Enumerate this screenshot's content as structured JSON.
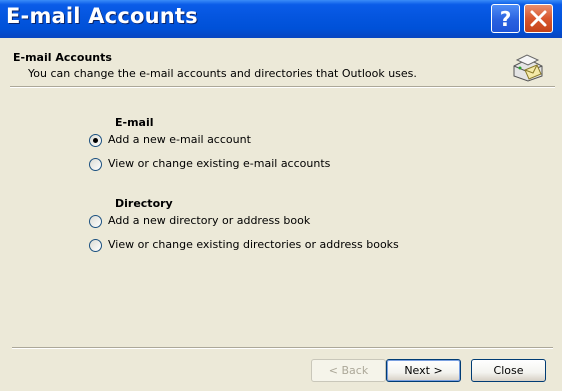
{
  "window": {
    "title": "E-mail Accounts",
    "colors": {
      "titlebar": "#0556e0",
      "face": "#ece9d8",
      "close_button": "#d9572e"
    }
  },
  "header": {
    "title": "E-mail Accounts",
    "description": "You can change the e-mail accounts and directories that Outlook uses.",
    "icon": "email-accounts-icon"
  },
  "email_section": {
    "title": "E-mail",
    "options": [
      {
        "label": "Add a new e-mail account",
        "checked": true
      },
      {
        "label": "View or change existing e-mail accounts",
        "checked": false
      }
    ]
  },
  "directory_section": {
    "title": "Directory",
    "options": [
      {
        "label": "Add a new directory or address book",
        "checked": false
      },
      {
        "label": "View or change existing directories or address books",
        "checked": false
      }
    ]
  },
  "buttons": {
    "back": "< Back",
    "next": "Next >",
    "close": "Close"
  }
}
